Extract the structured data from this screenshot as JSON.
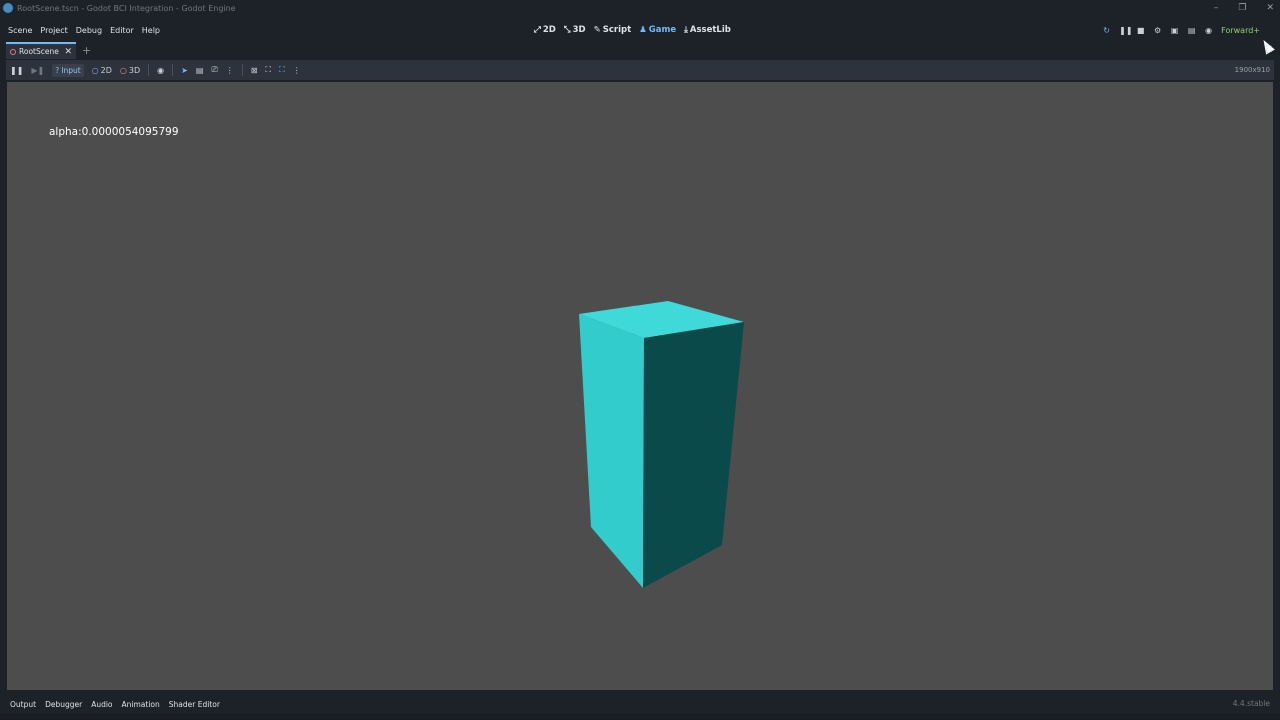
{
  "window": {
    "title": "RootScene.tscn - Godot BCI Integration - Godot Engine",
    "controls": [
      "–",
      "❐",
      "✕"
    ]
  },
  "menu": [
    "Scene",
    "Project",
    "Debug",
    "Editor",
    "Help"
  ],
  "main_screens": [
    {
      "icon": "2d-icon",
      "glyph": "⤢",
      "label": "2D"
    },
    {
      "icon": "3d-icon",
      "glyph": "⤡",
      "label": "3D"
    },
    {
      "icon": "script-icon",
      "glyph": "✎",
      "label": "Script"
    },
    {
      "icon": "game-icon",
      "glyph": "♟",
      "label": "Game"
    },
    {
      "icon": "assetlib-icon",
      "glyph": "⤓",
      "label": "AssetLib"
    }
  ],
  "active_screen": "Game",
  "run_bar": {
    "renderer": "Forward+"
  },
  "tabs": [
    {
      "label": "RootScene",
      "close": "✕"
    }
  ],
  "tab_add": "+",
  "game_toolbar": {
    "input_label": "Input",
    "node_2d_label": "2D",
    "node_3d_label": "3D",
    "resolution": "1900x910"
  },
  "viewport": {
    "alpha_text": "alpha:0.0000054095799",
    "background": "#4d4d4d",
    "cube_colors": {
      "front": "#33cccc",
      "side": "#0a4a4a",
      "top": "#3fd9d9"
    }
  },
  "bottom_tabs": [
    "Output",
    "Debugger",
    "Audio",
    "Animation",
    "Shader Editor"
  ],
  "version": "4.4.stable",
  "colors": {
    "accent": "#70bafa",
    "renderer": "#8fd16b",
    "editor_bg": "#1d2229",
    "panel_bg": "#2d333c"
  }
}
